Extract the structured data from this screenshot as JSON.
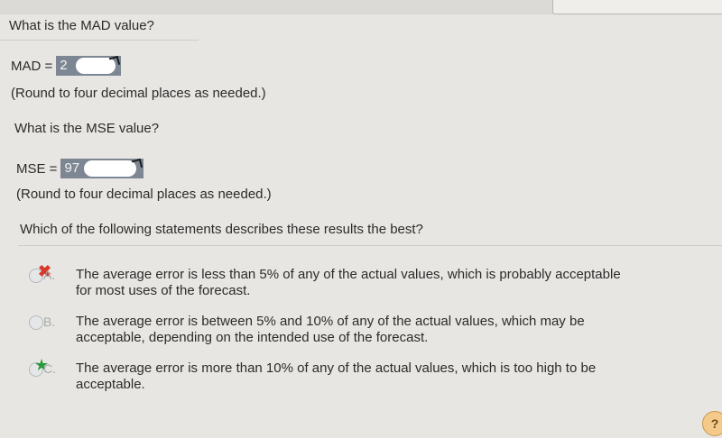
{
  "q_mad": "What is the MAD value?",
  "mad": {
    "label": "MAD =",
    "value": "2",
    "hint": "(Round to four decimal places as needed.)"
  },
  "q_mse": "What is the MSE value?",
  "mse": {
    "label": "MSE =",
    "value": "97",
    "hint": "(Round to four decimal places as needed.)"
  },
  "q_best": "Which of the following statements describes these results the best?",
  "options": [
    {
      "letter": "A.",
      "line1": "The average error is less than 5% of any of the actual values, which is probably acceptable",
      "line2": "for most uses of the forecast.",
      "status": "selected-incorrect"
    },
    {
      "letter": "B.",
      "line1": "The average error is between 5% and 10% of any of the actual values, which may be",
      "line2": "acceptable, depending on the intended use of the forecast.",
      "status": "unselected"
    },
    {
      "letter": "C.",
      "line1": "The average error is more than 10% of any of the actual values, which is too high to be",
      "line2": "acceptable.",
      "status": "correct"
    }
  ],
  "help_label": "?"
}
